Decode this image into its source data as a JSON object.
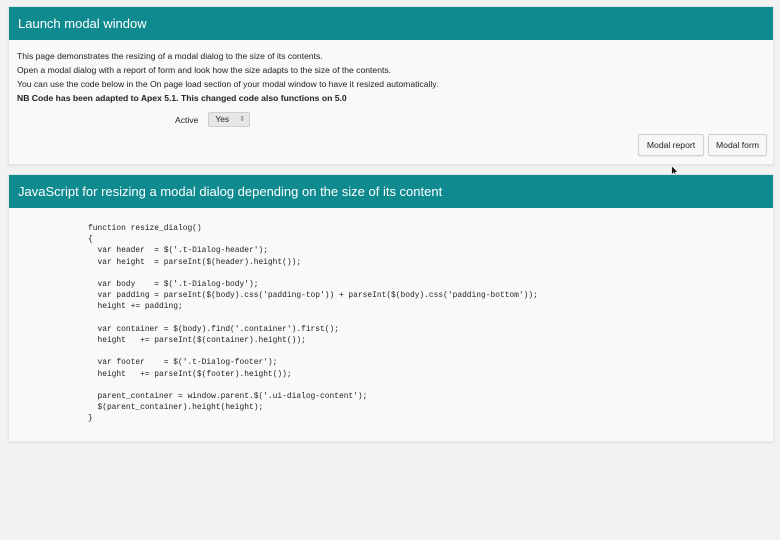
{
  "colors": {
    "header_bg": "#0f8a8f",
    "page_bg": "#f2f2f2",
    "region_bg": "#f9f9f9"
  },
  "launch_region": {
    "title": "Launch modal window",
    "lines": [
      "This page demonstrates the resizing of a modal dialog to the size of its contents.",
      "Open a modal dialog with a report of form and look how the size adapts to the size of the contents.",
      "You can use the code below in the On page load section of your modal window to have it resized automatically."
    ],
    "bold_line": "NB Code has been adapted to Apex 5.1. This changed code also functions on 5.0",
    "active_label": "Active",
    "active_value": "Yes",
    "buttons": {
      "modal_report": "Modal report",
      "modal_form": "Modal form"
    }
  },
  "js_region": {
    "title": "JavaScript for resizing a modal dialog depending on the size of its content",
    "code": "function resize_dialog()\n{\n  var header  = $('.t-Dialog-header');\n  var height  = parseInt($(header).height());\n\n  var body    = $('.t-Dialog-body');\n  var padding = parseInt($(body).css('padding-top')) + parseInt($(body).css('padding-bottom'));\n  height += padding;\n\n  var container = $(body).find('.container').first();\n  height   += parseInt($(container).height());\n\n  var footer    = $('.t-Dialog-footer');\n  height   += parseInt($(footer).height());\n\n  parent_container = window.parent.$('.ui-dialog-content');\n  $(parent_container).height(height);\n}"
  },
  "icons": {
    "cursor": "mouse-pointer-icon",
    "select_arrows": "up-down-arrows-icon"
  }
}
